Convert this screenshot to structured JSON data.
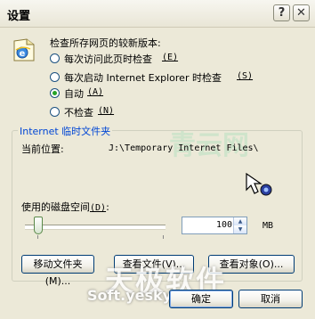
{
  "window": {
    "title": "设置",
    "help_button": "?",
    "close_button": "✕"
  },
  "check": {
    "heading": "检查所存网页的较新版本:",
    "options": [
      {
        "label": "每次访问此页时检查",
        "accel": "(E)",
        "checked": false
      },
      {
        "label": "每次启动 Internet Explorer 时检查",
        "accel": "(S)",
        "checked": false
      },
      {
        "label": "自动",
        "accel": "(A)",
        "checked": true
      },
      {
        "label": "不检查",
        "accel": "(N)",
        "checked": false
      }
    ]
  },
  "temp_files": {
    "group_title": "Internet 临时文件夹",
    "current_location_label": "当前位置:",
    "current_location_value": "J:\\Temporary Internet Files\\",
    "disk_space_label": "使用的磁盘空间",
    "disk_space_accel": "(D)",
    "disk_space_value": "100",
    "disk_space_unit": "MB",
    "slider_fraction": 0.07
  },
  "buttons": {
    "move_folder": "移动文件夹(M)...",
    "view_files": "查看文件(V)...",
    "view_objects": "查看对象(O)...",
    "ok": "确定",
    "cancel": "取消"
  },
  "watermarks": {
    "top": "青云网",
    "main": "天极软件",
    "sub": "Soft.yesky.com"
  },
  "icons": {
    "ie_page": "ie-page-icon",
    "cursor": "arrow-cursor-icon"
  }
}
